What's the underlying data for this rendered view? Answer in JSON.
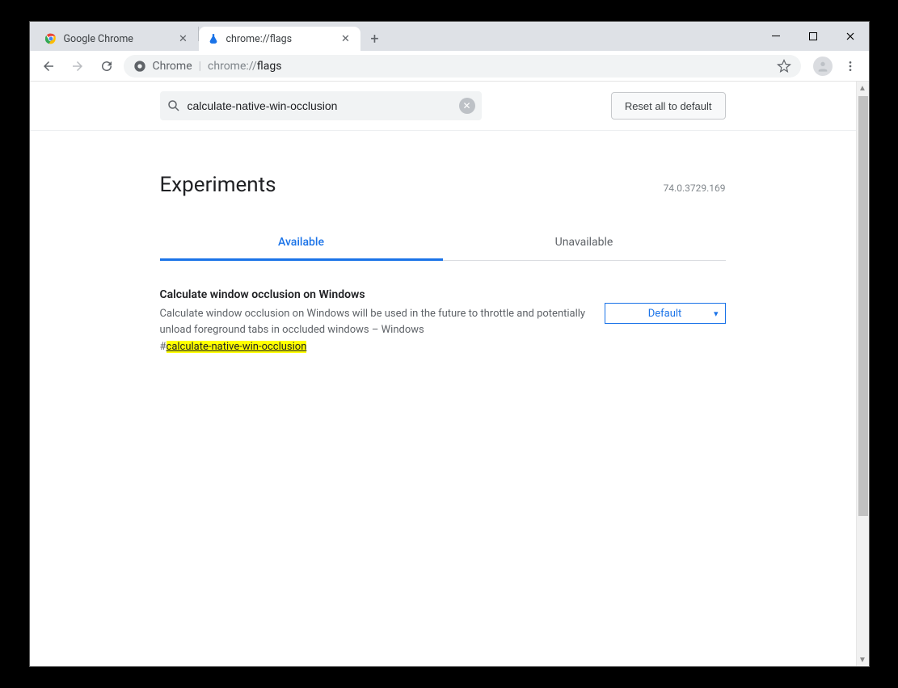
{
  "window": {
    "tabs": [
      {
        "label": "Google Chrome",
        "active": false
      },
      {
        "label": "chrome://flags",
        "active": true
      }
    ]
  },
  "toolbar": {
    "omnibox": {
      "chip": "Chrome",
      "url_prefix": "chrome://",
      "url_bold": "flags"
    }
  },
  "flags": {
    "search_value": "calculate-native-win-occlusion",
    "reset_label": "Reset all to default",
    "page_title": "Experiments",
    "version": "74.0.3729.169",
    "tabs": {
      "available": "Available",
      "unavailable": "Unavailable"
    },
    "item": {
      "title": "Calculate window occlusion on Windows",
      "description": "Calculate window occlusion on Windows will be used in the future to throttle and potentially unload foreground tabs in occluded windows – Windows",
      "anchor_hash": "#",
      "anchor_id": "calculate-native-win-occlusion",
      "select_value": "Default"
    }
  }
}
